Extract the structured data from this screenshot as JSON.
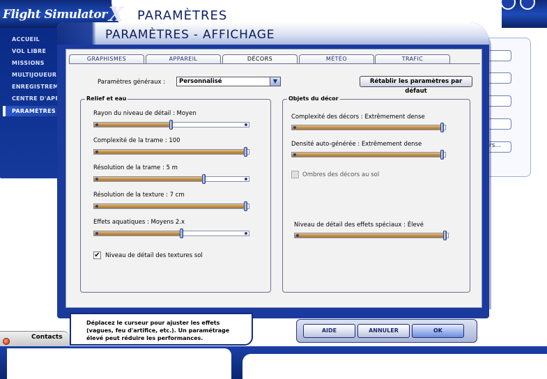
{
  "app": {
    "logo_text": "Flight Simulator",
    "logo_x": "X",
    "background_title": "PARAMÈTRES"
  },
  "sidebar": {
    "items": [
      {
        "label": "ACCUEIL"
      },
      {
        "label": "VOL LIBRE"
      },
      {
        "label": "MISSIONS"
      },
      {
        "label": "MULTIJOUEUR"
      },
      {
        "label": "ENREGISTREMENTS"
      },
      {
        "label": "CENTRE D'APPRENTISSAGE"
      },
      {
        "label": "PARAMÈTRES"
      }
    ],
    "active_index": 6
  },
  "background_right": {
    "partial_button_label": "rs..."
  },
  "contacts": {
    "label": "Contacts"
  },
  "dialog": {
    "title": "PARAMÈTRES - AFFICHAGE",
    "tabs": [
      {
        "label": "GRAPHISMES"
      },
      {
        "label": "APPAREIL"
      },
      {
        "label": "DÉCORS"
      },
      {
        "label": "MÉTÉO"
      },
      {
        "label": "TRAFIC"
      }
    ],
    "active_tab": 2,
    "general": {
      "label": "Paramètres généraux :",
      "value": "Personnalisé"
    },
    "reset_button": "Rétablir les paramètres par défaut",
    "terrain_group": {
      "title": "Relief et eau",
      "sliders": [
        {
          "label": "Rayon du niveau de détail : Moyen",
          "level": 0.5
        },
        {
          "label": "Complexité de la trame : 100",
          "level": 1.0
        },
        {
          "label": "Résolution de la trame : 5 m",
          "level": 0.72
        },
        {
          "label": "Résolution de la texture : 7 cm",
          "level": 1.0
        },
        {
          "label": "Effets aquatiques : Moyens 2.x",
          "level": 0.57
        }
      ],
      "checkbox": {
        "label": "Niveau de détail des textures sol",
        "checked": true
      }
    },
    "scenery_group": {
      "title": "Objets du décor",
      "sliders": [
        {
          "label": "Complexité des décors : Extrêmement dense",
          "level": 1.0
        },
        {
          "label": "Densité auto-générée : Extrêmement dense",
          "level": 1.0
        }
      ],
      "checkbox": {
        "label": "Ombres des décors au sol",
        "checked": false
      },
      "effects_slider": {
        "label": "Niveau de détail des effets spéciaux : Élevé",
        "level": 1.0
      }
    },
    "help_text": "Déplacez le curseur pour ajuster les effets (vagues, feu d'artifice, etc.). Un paramétrage élevé peut réduire les performances.",
    "buttons": {
      "help": "AIDE",
      "cancel": "ANNULER",
      "ok": "OK"
    }
  },
  "colors": {
    "accent_blue": "#1a3a9e",
    "slider_fill": "#c0904a"
  }
}
